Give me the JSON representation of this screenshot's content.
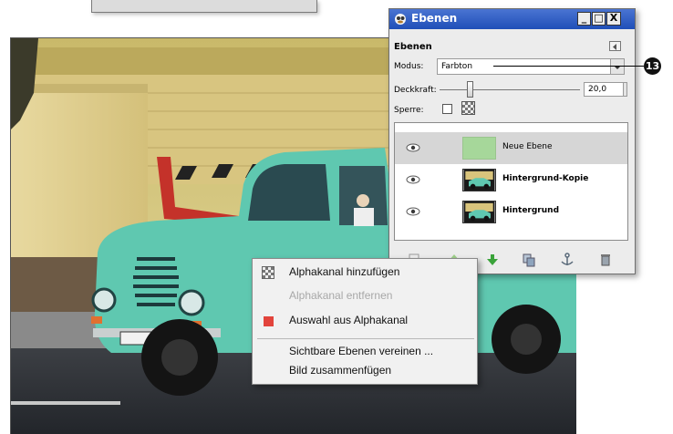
{
  "layers_dialog": {
    "window_title": "Ebenen",
    "heading": "Ebenen",
    "mode_label": "Modus:",
    "mode_value": "Farbton",
    "opacity_label": "Deckkraft:",
    "opacity_value": "20,0",
    "opacity_fraction": 0.2,
    "lock_label": "Sperre:",
    "layers": [
      {
        "name": "Neue Ebene",
        "selected": true,
        "thumbnail": "solid-green"
      },
      {
        "name": "Hintergrund-Kopie",
        "selected": false,
        "thumbnail": "truck-photo"
      },
      {
        "name": "Hintergrund",
        "selected": false,
        "thumbnail": "truck-photo"
      }
    ],
    "window_buttons": [
      "_",
      "□",
      "X"
    ]
  },
  "callout": {
    "number": "13"
  },
  "context_menu": {
    "items": [
      {
        "label": "Alphakanal hinzufügen",
        "enabled": true,
        "icon": "checker-icon"
      },
      {
        "label": "Alphakanal entfernen",
        "enabled": false,
        "icon": ""
      },
      {
        "label": "Auswahl aus Alphakanal",
        "enabled": true,
        "icon": "red-square-icon"
      },
      {
        "label": "Sichtbare Ebenen vereinen ...",
        "enabled": true,
        "icon": ""
      },
      {
        "label": "Bild zusammenfügen",
        "enabled": true,
        "icon": ""
      }
    ]
  },
  "colors": {
    "title_bar": "#2c5bc4",
    "truck_body": "#5fc8b0",
    "new_layer_swatch": "#a6d79a"
  }
}
